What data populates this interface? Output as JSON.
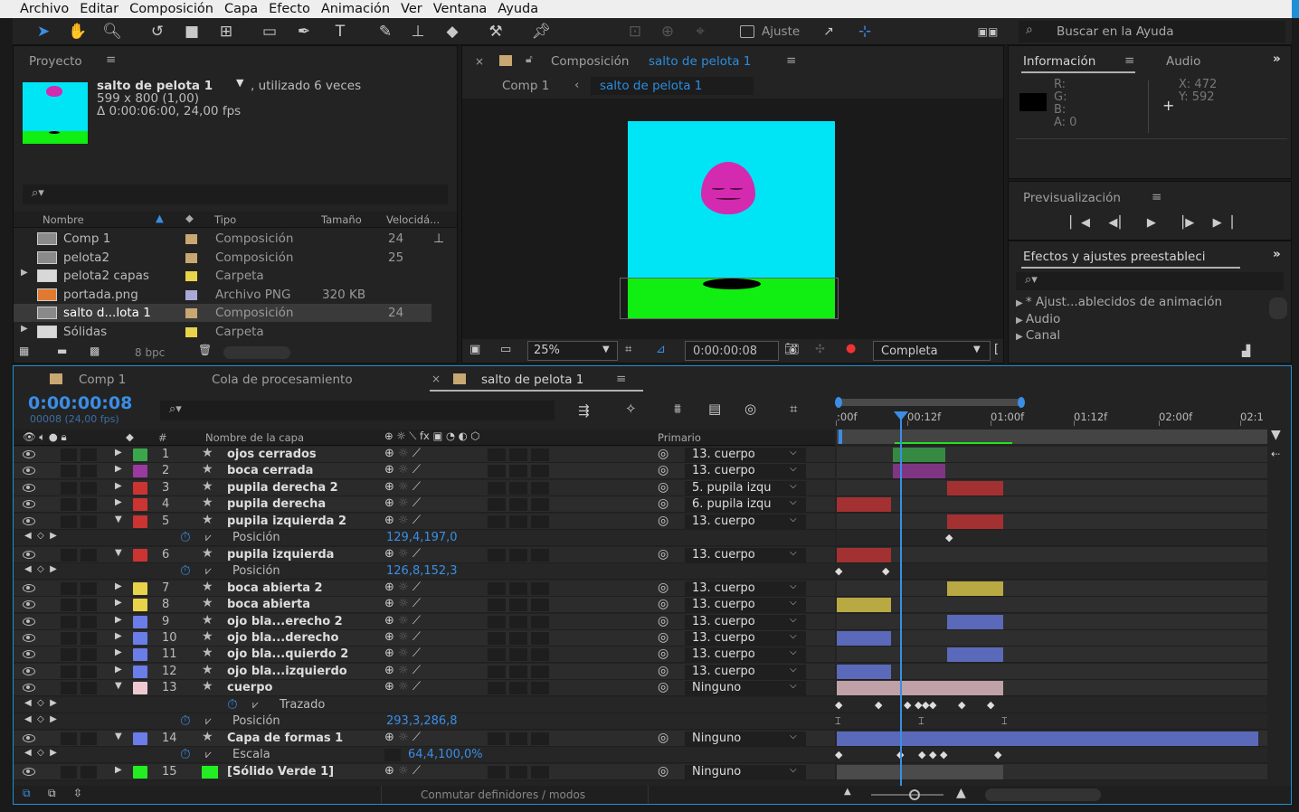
{
  "menu": [
    "Archivo",
    "Editar",
    "Composición",
    "Capa",
    "Efecto",
    "Animación",
    "Ver",
    "Ventana",
    "Ayuda"
  ],
  "toolbar": {
    "ajuste": "Ajuste",
    "help_placeholder": "Buscar en la Ayuda"
  },
  "project": {
    "title": "Proyecto",
    "item_name": "salto de pelota 1",
    "item_usage": ", utilizado 6 veces",
    "item_dims": "599 x 800 (1,00)",
    "item_duration": "Δ 0:00:06:00, 24,00 fps",
    "cols": {
      "name": "Nombre",
      "type": "Tipo",
      "size": "Tamaño",
      "speed": "Velocidá..."
    },
    "items": [
      {
        "name": "Comp 1",
        "type": "Composición",
        "size": "",
        "speed": "24",
        "color": "#c9a773",
        "icon": "comp-icon"
      },
      {
        "name": "pelota2",
        "type": "Composición",
        "size": "",
        "speed": "25",
        "color": "#c9a773",
        "icon": "comp-icon"
      },
      {
        "name": "pelota2 capas",
        "type": "Carpeta",
        "size": "",
        "speed": "",
        "color": "#e8d34a",
        "icon": "folder-icon"
      },
      {
        "name": "portada.png",
        "type": "Archivo PNG",
        "size": "320 KB",
        "speed": "",
        "color": "#a9a9d8",
        "icon": "image-icon"
      },
      {
        "name": "salto d...lota 1",
        "type": "Composición",
        "size": "",
        "speed": "24",
        "color": "#c9a773",
        "icon": "comp-icon"
      },
      {
        "name": "Sólidas",
        "type": "Carpeta",
        "size": "",
        "speed": "",
        "color": "#e8d34a",
        "icon": "folder-icon"
      }
    ],
    "bpc": "8 bpc"
  },
  "viewer": {
    "tab_prefix": "Composición",
    "tab_name": "salto de pelota 1",
    "crumb1": "Comp 1",
    "crumb2": "salto de pelota 1",
    "zoom": "25%",
    "timecode": "0:00:00:08",
    "resolution": "Completa"
  },
  "info": {
    "tab_info": "Información",
    "tab_audio": "Audio",
    "r": "R:",
    "g": "G:",
    "b": "B:",
    "a": "A:  0",
    "x": "X:  472",
    "y": "Y:  592"
  },
  "preview": {
    "title": "Previsualización"
  },
  "effects": {
    "title": "Efectos y ajustes preestableci",
    "items": [
      "* Ajust...ablecidos de animación",
      "Audio",
      "Canal"
    ]
  },
  "timeline": {
    "tabs": [
      "Comp 1",
      "Cola de procesamiento",
      "salto de pelota 1"
    ],
    "timecode": "0:00:00:08",
    "frames": "00008 (24,00 fps)",
    "col_name": "Nombre de la capa",
    "col_parent": "Primario",
    "ruler": [
      ":00f",
      "00:12f",
      "01:00f",
      "01:12f",
      "02:00f",
      "02:1"
    ],
    "footer": "Conmutar definidores / modos",
    "layers": [
      {
        "num": "1",
        "name": "ojos cerrados",
        "parent": "13. cuerpo",
        "color": "#3aa84a",
        "expanded": false
      },
      {
        "num": "2",
        "name": "boca cerrada",
        "parent": "13. cuerpo",
        "color": "#9a3aa0",
        "expanded": false
      },
      {
        "num": "3",
        "name": "pupila derecha 2",
        "parent": "5. pupila izqu",
        "color": "#c33",
        "expanded": false
      },
      {
        "num": "4",
        "name": "pupila derecha",
        "parent": "6. pupila izqu",
        "color": "#c33",
        "expanded": false
      },
      {
        "num": "5",
        "name": "pupila izquierda 2",
        "parent": "13. cuerpo",
        "color": "#c33",
        "expanded": true
      },
      {
        "prop": "Posición",
        "value": "129,4,197,0"
      },
      {
        "num": "6",
        "name": "pupila izquierda",
        "parent": "13. cuerpo",
        "color": "#c33",
        "expanded": true
      },
      {
        "prop": "Posición",
        "value": "126,8,152,3"
      },
      {
        "num": "7",
        "name": "boca abierta 2",
        "parent": "13. cuerpo",
        "color": "#e8d34a",
        "expanded": false
      },
      {
        "num": "8",
        "name": "boca abierta",
        "parent": "13. cuerpo",
        "color": "#e8d34a",
        "expanded": false
      },
      {
        "num": "9",
        "name": "ojo bla...erecho 2",
        "parent": "13. cuerpo",
        "color": "#6a7de8",
        "expanded": false
      },
      {
        "num": "10",
        "name": "ojo bla...derecho",
        "parent": "13. cuerpo",
        "color": "#6a7de8",
        "expanded": false
      },
      {
        "num": "11",
        "name": "ojo bla...quierdo 2",
        "parent": "13. cuerpo",
        "color": "#6a7de8",
        "expanded": false
      },
      {
        "num": "12",
        "name": "ojo bla...izquierdo",
        "parent": "13. cuerpo",
        "color": "#6a7de8",
        "expanded": false
      },
      {
        "num": "13",
        "name": "cuerpo",
        "parent": "Ninguno",
        "color": "#f0c8d0",
        "expanded": true
      },
      {
        "prop": "Trazado",
        "value": ""
      },
      {
        "prop": "Posición",
        "value": "293,3,286,8"
      },
      {
        "num": "14",
        "name": "Capa de formas 1",
        "parent": "Ninguno",
        "color": "#6a7de8",
        "expanded": true
      },
      {
        "prop": "Escala",
        "value": "64,4,100,0%"
      },
      {
        "num": "15",
        "name": "[Sólido Verde 1]",
        "parent": "Ninguno",
        "color": "#22ee22",
        "expanded": false
      }
    ]
  }
}
